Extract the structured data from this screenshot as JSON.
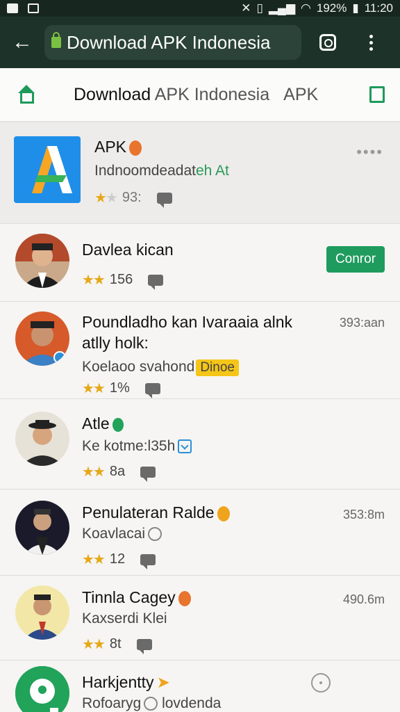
{
  "status_bar": {
    "battery": "192%",
    "time": "11:20"
  },
  "browser": {
    "url_text": "Download APK Indonesia"
  },
  "tabs": {
    "title_main": "Download ",
    "title_rest": "APK Indonesia",
    "apk": "APK"
  },
  "featured": {
    "title": "APK",
    "subtitle_a": "Indnoomdeadat",
    "subtitle_b": "eh At",
    "rating_text": "93:",
    "more": "••••"
  },
  "list": [
    {
      "title": "Davlea kican",
      "count": "156",
      "button": "Conror"
    },
    {
      "title": "Poundladho kan Ivaraaia alnk atlly holk:",
      "subtitle": "Koelaoo svahond",
      "badge": "Dinoe",
      "count": "1%",
      "time": "393:aan"
    },
    {
      "title": "Atle",
      "subtitle": "Ke kotme:l35h",
      "count": "8a"
    },
    {
      "title": "Penulateran Ralde",
      "subtitle": "Koavlacai",
      "count": "12",
      "time": "353:8m"
    },
    {
      "title": "Tinnla Cagey",
      "subtitle": "Kaxserdi Klei",
      "count": "8t",
      "time": "490.6m"
    },
    {
      "title": "Harkjentty",
      "subtitle": "Rofoaryg",
      "subtitle_b": "lovdenda"
    }
  ],
  "colors": {
    "appbar": "#1d3329",
    "accent_green": "#1f9b5e",
    "star": "#e6a817"
  }
}
